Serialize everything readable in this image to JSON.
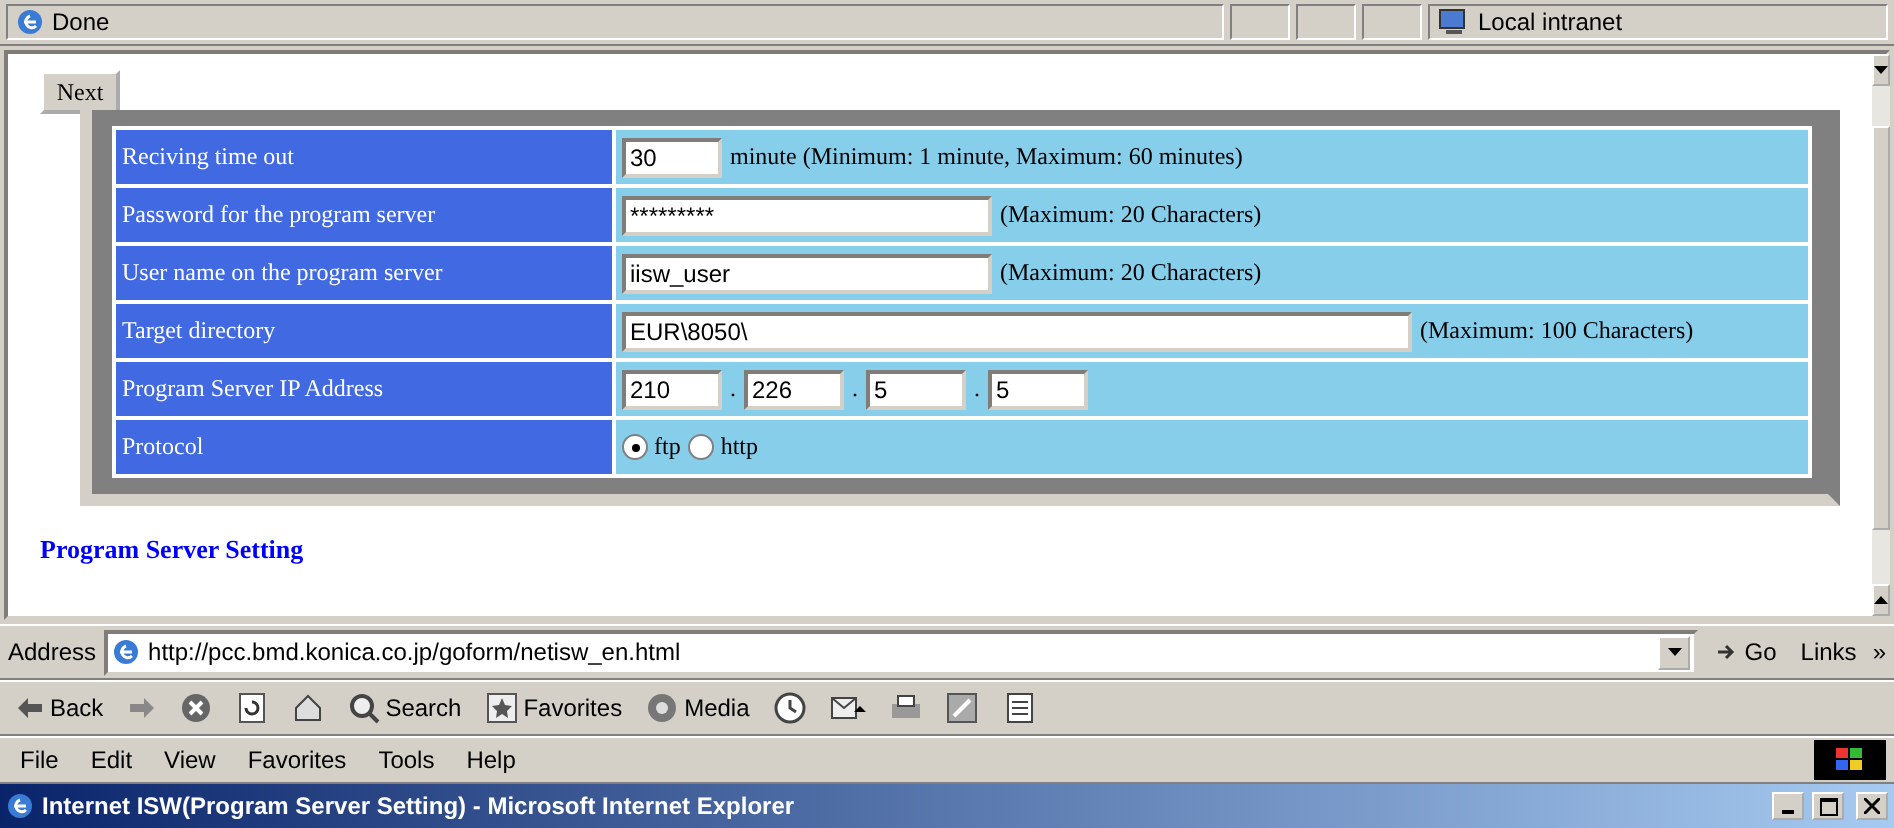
{
  "status_bar": {
    "text": "Done",
    "zone": "Local intranet"
  },
  "next_button": {
    "label": "Next"
  },
  "settings": [
    {
      "kind": "number",
      "label": "Reciving time out",
      "value": "30",
      "note": "minute (Minimum: 1 minute, Maximum: 60 minutes)"
    },
    {
      "kind": "password",
      "label": "Password for the program server",
      "value": "*********",
      "note": "(Maximum: 20 Characters)"
    },
    {
      "kind": "text",
      "label": "User name on the program server",
      "value": "iisw_user",
      "note": "(Maximum: 20 Characters)"
    },
    {
      "kind": "path",
      "label": "Target directory",
      "value": "EUR\\8050\\",
      "note": "(Maximum: 100 Characters)"
    },
    {
      "kind": "ip",
      "label": "Program Server IP Address",
      "octets": [
        "210",
        "226",
        "5",
        "5"
      ],
      "separators": [
        ".",
        ".",
        "."
      ]
    },
    {
      "kind": "radio",
      "label": "Protocol",
      "options": [
        {
          "label": "ftp",
          "selected": true
        },
        {
          "label": "http",
          "selected": false
        }
      ]
    }
  ],
  "heading": "Program Server Setting",
  "address_bar": {
    "label": "Address",
    "url": "http://pcc.bmd.konica.co.jp/goform/netisw_en.html",
    "go": "Go",
    "links": "Links",
    "more": "»"
  },
  "toolbar": [
    {
      "kind": "back",
      "label": "Back"
    },
    {
      "kind": "forward"
    },
    {
      "kind": "stop"
    },
    {
      "kind": "refresh"
    },
    {
      "kind": "home"
    },
    {
      "kind": "search",
      "label": "Search"
    },
    {
      "kind": "favorites",
      "label": "Favorites"
    },
    {
      "kind": "media",
      "label": "Media"
    },
    {
      "kind": "history"
    },
    {
      "kind": "mail"
    },
    {
      "kind": "print"
    },
    {
      "kind": "edit"
    },
    {
      "kind": "discuss"
    }
  ],
  "menu": [
    "File",
    "Edit",
    "View",
    "Favorites",
    "Tools",
    "Help"
  ],
  "window": {
    "title": "Internet ISW(Program Server Setting) - Microsoft Internet Explorer"
  }
}
